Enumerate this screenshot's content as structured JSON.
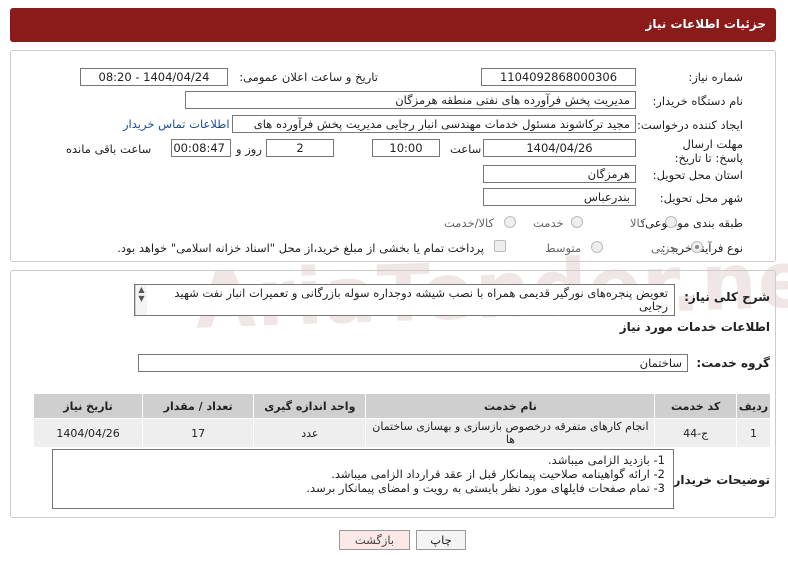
{
  "header": {
    "title": "جزئیات اطلاعات نیاز"
  },
  "watermark": "AriaTender.neT",
  "form": {
    "need_number_label": "شماره نیاز:",
    "need_number": "1104092868000306",
    "announce_label": "تاریخ و ساعت اعلان عمومی:",
    "announce_value": "1404/04/24 - 08:20",
    "buyer_org_label": "نام دستگاه خریدار:",
    "buyer_org": "مدیریت پخش فرآورده های نفتی منطقه هرمزگان",
    "creator_label": "ایجاد کننده درخواست:",
    "creator": "مجید ترکاشوند مسئول خدمات مهندسی انبار رجایی مدیریت پخش فرآورده های",
    "contact_link": "اطلاعات تماس خریدار",
    "deadline_label": "مهلت ارسال پاسخ: تا تاریخ:",
    "deadline_date": "1404/04/26",
    "time_label": "ساعت",
    "deadline_time": "10:00",
    "days_value": "2",
    "days_label": "روز و",
    "remaining_time": "00:08:47",
    "remaining_label": "ساعت باقی مانده",
    "province_label": "استان محل تحویل:",
    "province": "هرمزگان",
    "city_label": "شهر محل تحویل:",
    "city": "بندرعباس",
    "category_label": "طبقه بندی موضوعی:",
    "category_options": [
      "کالا",
      "خدمت",
      "کالا/خدمت"
    ],
    "process_label": "نوع فرآیند خرید :",
    "process_options": [
      "جزیی",
      "متوسط"
    ],
    "payment_note": "پرداخت تمام یا بخشی از مبلغ خرید،از محل \"اسناد خزانه اسلامی\" خواهد بود."
  },
  "general": {
    "desc_label": "شرح کلی نیاز:",
    "desc": "تعویض پنجره‌های نورگیر قدیمی همراه با نصب شیشه دوجداره سوله بازرگانی و تعمیرات انبار نفت شهید رجایی",
    "services_title": "اطلاعات خدمات مورد نیاز",
    "group_label": "گروه خدمت:",
    "group": "ساختمان"
  },
  "table": {
    "headers": [
      "ردیف",
      "کد خدمت",
      "نام خدمت",
      "واحد اندازه گیری",
      "تعداد / مقدار",
      "تاریخ نیاز"
    ],
    "rows": [
      [
        "1",
        "ج-44",
        "انجام کارهای متفرقه درخصوص بازسازی و بهسازی ساختمان ها",
        "عدد",
        "17",
        "1404/04/26"
      ]
    ]
  },
  "notes": {
    "label": "توضیحات خریدار:",
    "lines": [
      "1-   بازدید الزامی میباشد.",
      "2-   ارائه گواهینامه صلاحیت پیمانکار قبل از عقد قرارداد الزامی میباشد.",
      "3-   تمام صفحات فایلهای مورد نظر بایستی به رویت و امضای پیمانکار برسد."
    ]
  },
  "buttons": {
    "print": "چاپ",
    "back": "بازگشت"
  }
}
